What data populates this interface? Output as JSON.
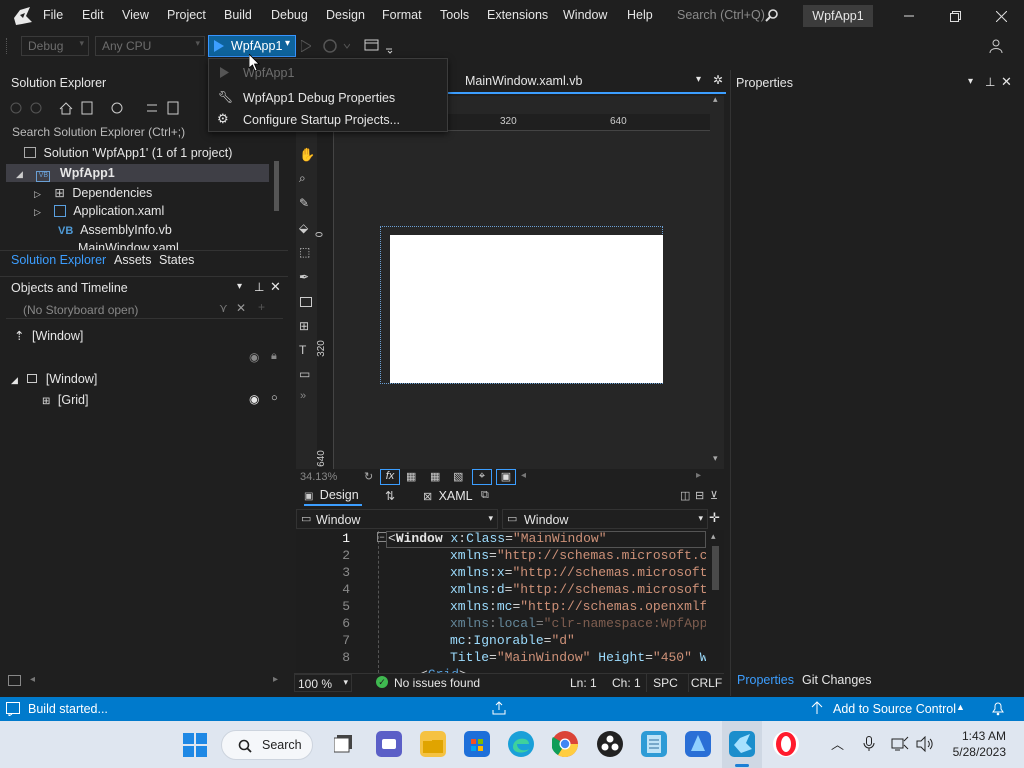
{
  "menubar": {
    "items": [
      "File",
      "Edit",
      "View",
      "Project",
      "Build",
      "Debug",
      "Design",
      "Format",
      "Tools",
      "Extensions",
      "Window",
      "Help"
    ],
    "search_placeholder": "Search (Ctrl+Q)",
    "solution_badge": "WpfApp1"
  },
  "toolbar": {
    "config": "Debug",
    "platform": "Any CPU",
    "run_target": "WpfApp1"
  },
  "run_dropdown": {
    "items": [
      "WpfApp1",
      "WpfApp1 Debug Properties",
      "Configure Startup Projects..."
    ]
  },
  "solution_explorer": {
    "title": "Solution Explorer",
    "search_placeholder": "Search Solution Explorer (Ctrl+;)",
    "tree": [
      {
        "label": "Solution 'WpfApp1' (1 of 1 project)"
      },
      {
        "label": "WpfApp1",
        "icon": "VB"
      },
      {
        "label": "Dependencies"
      },
      {
        "label": "Application.xaml"
      },
      {
        "label": "AssemblyInfo.vb",
        "icon": "VB"
      },
      {
        "label": "MainWindow.xaml"
      }
    ],
    "tabs": [
      "Solution Explorer",
      "Assets",
      "States"
    ]
  },
  "objects_timeline": {
    "title": "Objects and Timeline",
    "storyboard": "(No Storyboard open)",
    "root_label": "[Window]",
    "tree": [
      "[Window]",
      "[Grid]"
    ]
  },
  "document_tab": {
    "title": "MainWindow.xaml.vb"
  },
  "designer": {
    "ruler_top": [
      "320",
      "640"
    ],
    "ruler_left": [
      "0",
      "320",
      "640"
    ],
    "zoom": "34.13%",
    "design_tab": "Design",
    "xaml_tab": "XAML"
  },
  "xaml_editor": {
    "scope_left": "Window",
    "scope_right": "Window",
    "line_numbers": [
      "1",
      "2",
      "3",
      "4",
      "5",
      "6",
      "7",
      "8"
    ],
    "status": {
      "zoom": "100 %",
      "issues": "No issues found",
      "line": "Ln: 1",
      "col": "Ch: 1",
      "spc": "SPC",
      "crlf": "CRLF"
    }
  },
  "properties": {
    "title": "Properties",
    "tabs": [
      "Properties",
      "Git Changes"
    ]
  },
  "statusbar": {
    "message": "Build started...",
    "source_control": "Add to Source Control",
    "color": "#007acc"
  },
  "taskbar": {
    "search_label": "Search",
    "time": "1:43 AM",
    "date": "5/28/2023"
  }
}
